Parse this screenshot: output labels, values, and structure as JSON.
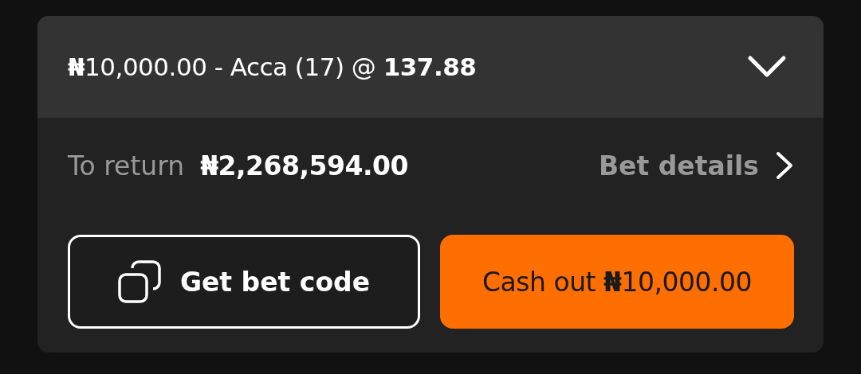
{
  "header": {
    "title": "**₦**10,000.00 - Acca (17) @ **137.88**"
  },
  "summary": {
    "label": "To return",
    "amount": "₦2,268,594.00",
    "link": "Bet details"
  },
  "buttons": [
    {
      "kind": "outline",
      "label": "Get bet code"
    },
    {
      "kind": "primary",
      "label": "Cash out **₦**10,000.00"
    }
  ]
}
